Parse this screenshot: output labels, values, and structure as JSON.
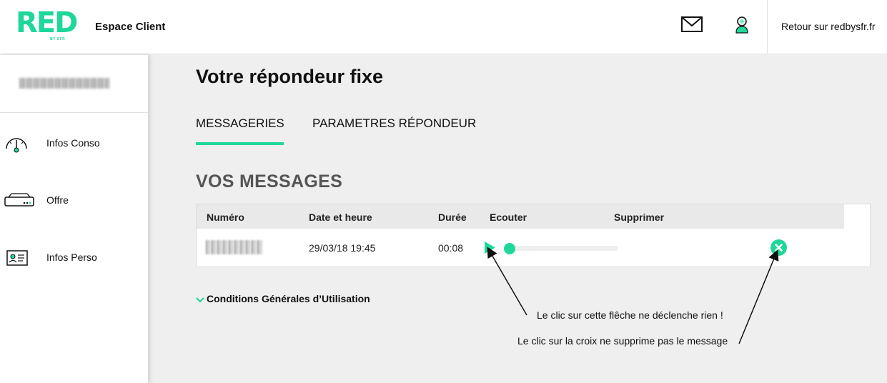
{
  "header": {
    "logo_text": "RED",
    "logo_sub": "BY SFR",
    "title": "Espace Client",
    "icons": [
      "mail-icon",
      "user-icon"
    ],
    "link": "Retour sur redbysfr.fr"
  },
  "sidebar": {
    "items": [
      {
        "label": "Infos Conso",
        "icon": "gauge-icon"
      },
      {
        "label": "Offre",
        "icon": "box-icon"
      },
      {
        "label": "Infos Perso",
        "icon": "id-card-icon"
      }
    ]
  },
  "main": {
    "title": "Votre répondeur fixe",
    "tabs": [
      {
        "label": "MESSAGERIES",
        "active": true
      },
      {
        "label": "PARAMETRES RÉPONDEUR",
        "active": false
      }
    ],
    "section_title": "VOS MESSAGES",
    "table": {
      "headers": [
        "Numéro",
        "Date et heure",
        "Durée",
        "Ecouter",
        "Supprimer"
      ],
      "rows": [
        {
          "date": "29/03/18 19:45",
          "duration": "00:08",
          "progress": 0
        }
      ]
    },
    "cgu": "Conditions Générales d’Utilisation"
  },
  "annotations": [
    "Le clic sur cette flêche ne déclenche rien !",
    "Le clic sur la croix ne supprime pas le message"
  ],
  "colors": {
    "accent": "#1fd79a",
    "background": "#efefef",
    "header_bg": "#ffffff"
  }
}
